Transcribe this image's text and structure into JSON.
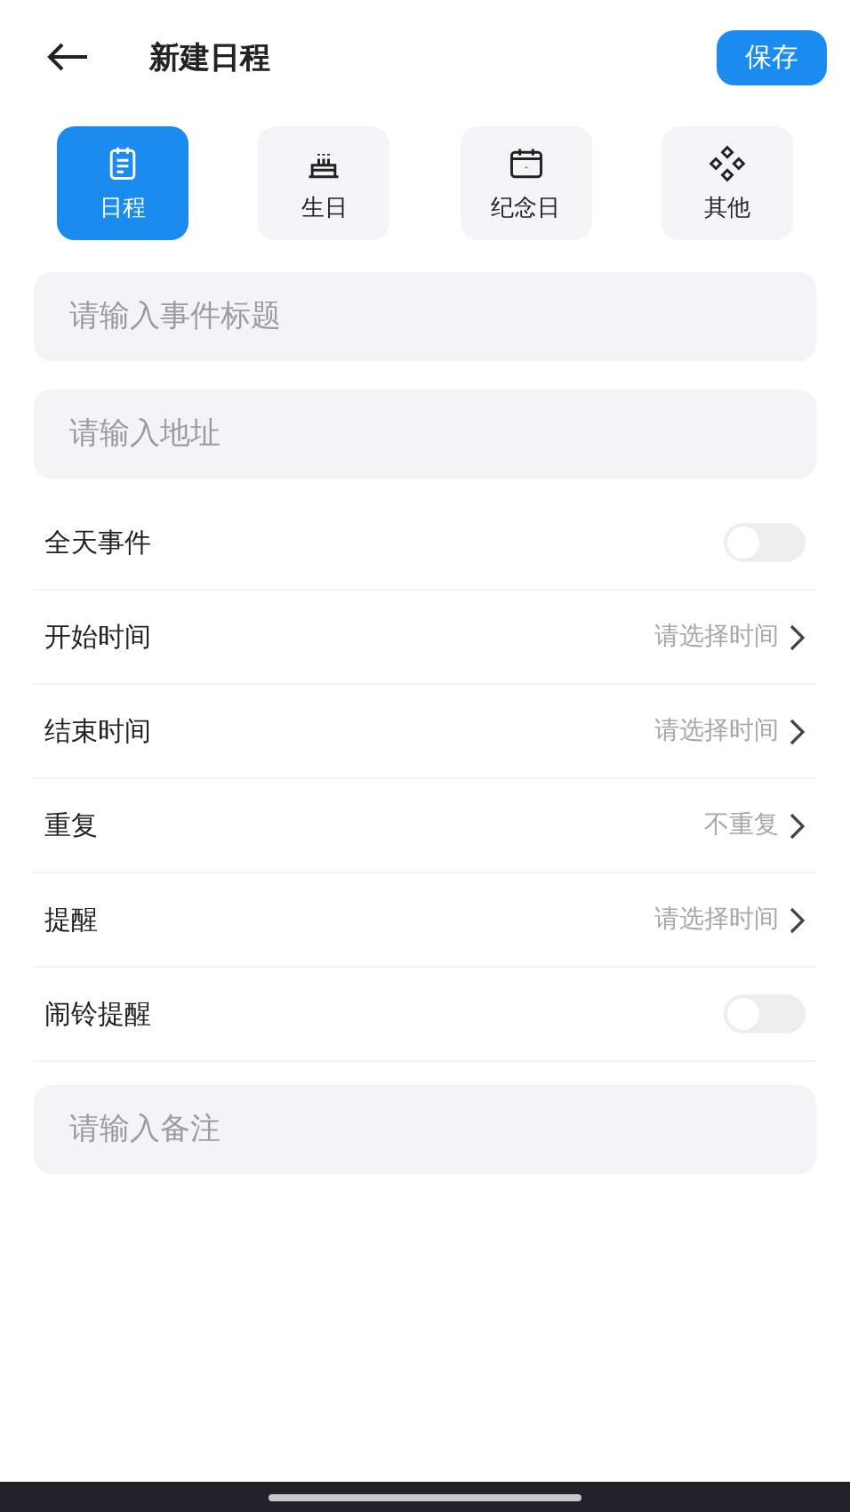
{
  "header": {
    "title": "新建日程",
    "save": "保存"
  },
  "types": [
    {
      "label": "日程",
      "kind": "note",
      "selected": true
    },
    {
      "label": "生日",
      "kind": "cake",
      "selected": false
    },
    {
      "label": "纪念日",
      "kind": "calendar",
      "selected": false
    },
    {
      "label": "其他",
      "kind": "diamonds",
      "selected": false
    }
  ],
  "fields": [
    {
      "placeholder": "请输入事件标题"
    },
    {
      "placeholder": "请输入地址"
    }
  ],
  "rows": [
    {
      "kind": "toggle",
      "label": "全天事件",
      "on": false
    },
    {
      "kind": "select",
      "label": "开始时间",
      "value": "请选择时间"
    },
    {
      "kind": "select",
      "label": "结束时间",
      "value": "请选择时间"
    },
    {
      "kind": "select",
      "label": "重复",
      "value": "不重复"
    },
    {
      "kind": "select",
      "label": "提醒",
      "value": "请选择时间"
    },
    {
      "kind": "toggle",
      "label": "闹铃提醒",
      "on": false
    }
  ],
  "notes": {
    "placeholder": "请输入备注"
  }
}
